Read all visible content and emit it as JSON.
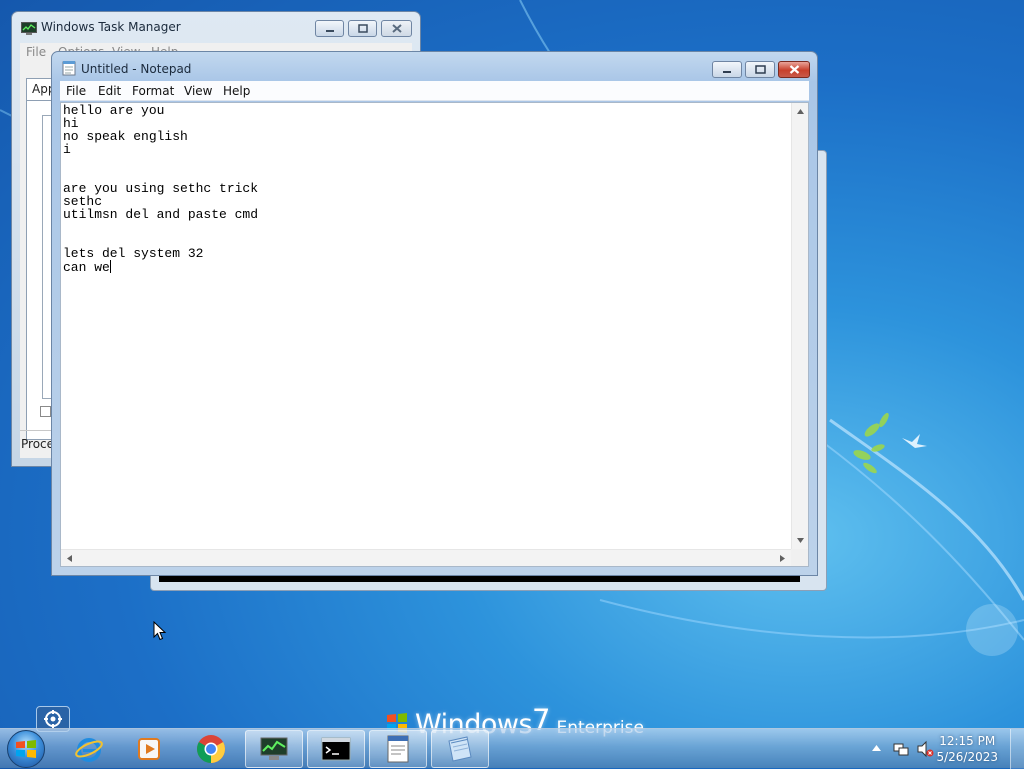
{
  "desktop": {
    "wordmark": {
      "windows": "Windows",
      "version": "7",
      "edition": "Enterprise"
    }
  },
  "task_manager": {
    "title": "Windows Task Manager",
    "menu": [
      "File",
      "Options",
      "View",
      "Help"
    ],
    "tab_label": "App",
    "status_label": "Proce"
  },
  "notepad": {
    "title": "Untitled - Notepad",
    "menu": [
      "File",
      "Edit",
      "Format",
      "View",
      "Help"
    ],
    "content": "hello are you\nhi\nno speak english\ni\n\n\nare you using sethc trick\nsethc\nutilmsn del and paste cmd\n\n\nlets del system 32\ncan we"
  },
  "taskbar": {
    "pinned": [
      "start-button",
      "internet-explorer",
      "windows-media-player",
      "google-chrome",
      "task-manager",
      "command-prompt",
      "notepad-running",
      "notepad"
    ],
    "clock_time": "12:15 PM",
    "clock_date": "5/26/2023"
  },
  "colors": {
    "desktop": "#1c6fc7",
    "close_button": "#c8402c",
    "title_active": "#a9c6e7"
  }
}
